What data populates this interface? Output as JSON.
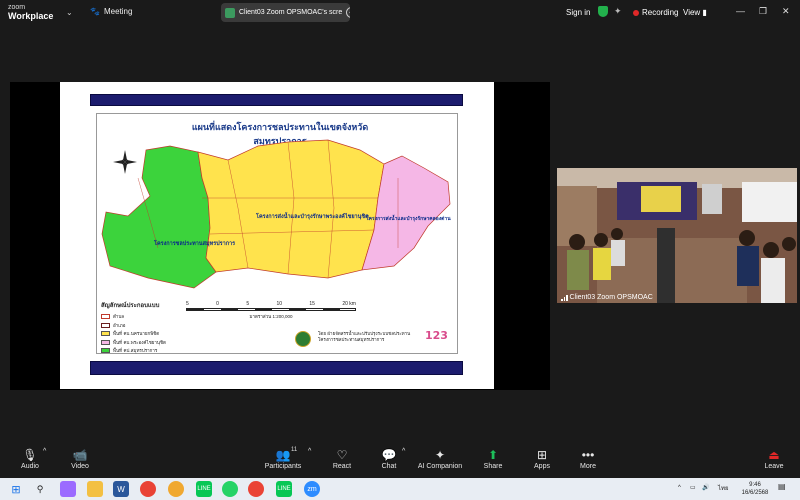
{
  "app": {
    "brand_top": "zoom",
    "brand_name": "Workplace",
    "meeting_label": "Meeting",
    "share_title": "Client03 Zoom OPSMOAC's scre",
    "sign_in": "Sign in",
    "recording": "Recording",
    "view": "View"
  },
  "slide": {
    "map_title": "แผนที่แสดงโครงการชลประทานในเขตจังหวัดสมุทรปราการ",
    "region_labels": [
      "โครงการชลประทานสมุทรปราการ",
      "โครงการส่งน้ำและบำรุงรักษาพระองค์ไชยานุชิต",
      "โครงการส่งน้ำและบำรุงรักษาคลองด่าน"
    ],
    "legend_title": "สัญลักษณ์ประกอบแบบ",
    "legend": [
      {
        "label": "ตำบล",
        "color": "#ffffff"
      },
      {
        "label": "อำเภอ",
        "color": "#ffffff"
      },
      {
        "label": "พื้นที่ คบ.นครนายกพิชิต",
        "color": "#ffe34d"
      },
      {
        "label": "พื้นที่ คบ.พระองค์ไชยานุชิต",
        "color": "#f5b7e6"
      },
      {
        "label": "พื้นที่ คป.สมุทรปราการ",
        "color": "#3cd33c"
      }
    ],
    "scale_ticks": [
      "5",
      "0",
      "5",
      "10",
      "15",
      "20 km"
    ],
    "scale_ratio": "มาตราส่วน 1:200,000",
    "credit_line1": "โดย ฝ่ายจัดสรรน้ำและปรับปรุงระบบชลประทาน",
    "credit_line2": "โครงการชลประทานสมุทรปราการ",
    "logo_text": "123"
  },
  "camera": {
    "label": "Client03 Zoom OPSMOAC"
  },
  "toolbar": {
    "audio": "Audio",
    "video": "Video",
    "participants": "Participants",
    "participants_count": "11",
    "react": "React",
    "chat": "Chat",
    "ai_companion": "AI Companion",
    "share": "Share",
    "apps": "Apps",
    "more": "More",
    "leave": "Leave"
  },
  "taskbar": {
    "lang": "ไทย",
    "time": "9:46",
    "date": "16/6/2568",
    "zoom_label": "zm"
  },
  "colors": {
    "green_area": "#3cd33c",
    "yellow_area": "#ffe34d",
    "pink_area": "#f5b7e6",
    "slide_bar": "#1c1c6e",
    "recording_dot": "#e02828"
  }
}
